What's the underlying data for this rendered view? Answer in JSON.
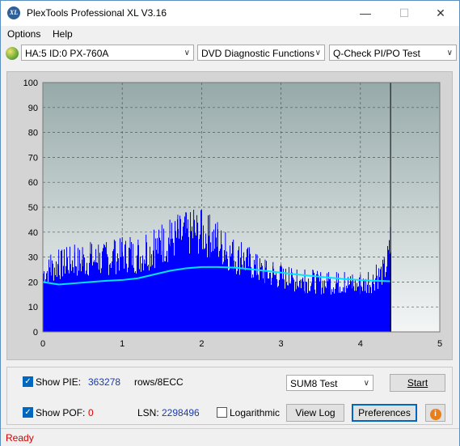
{
  "window": {
    "title": "PlexTools Professional XL V3.16",
    "icon": "xl-app-icon"
  },
  "menu": [
    {
      "label": "Options"
    },
    {
      "label": "Help"
    }
  ],
  "toolbar": {
    "drive": "HA:5 ID:0  PX-760A",
    "function": "DVD Diagnostic Functions",
    "test": "Q-Check PI/PO Test"
  },
  "chart_data": {
    "type": "bar",
    "title": "",
    "xlabel": "",
    "ylabel": "",
    "xlim": [
      0,
      5
    ],
    "ylim": [
      0,
      100
    ],
    "x_ticks": [
      "0",
      "1",
      "2",
      "3",
      "4",
      "5"
    ],
    "y_ticks": [
      "0",
      "10",
      "20",
      "30",
      "40",
      "50",
      "60",
      "70",
      "80",
      "90",
      "100"
    ],
    "grid": true,
    "end_marker_x": 4.38,
    "series": [
      {
        "name": "PIE",
        "color": "#0000ff",
        "x": [
          0.0,
          0.1,
          0.2,
          0.3,
          0.4,
          0.5,
          0.6,
          0.7,
          0.8,
          0.9,
          1.0,
          1.1,
          1.2,
          1.3,
          1.4,
          1.5,
          1.6,
          1.7,
          1.8,
          1.9,
          2.0,
          2.1,
          2.2,
          2.3,
          2.4,
          2.5,
          2.6,
          2.7,
          2.8,
          2.9,
          3.0,
          3.1,
          3.2,
          3.3,
          3.4,
          3.5,
          3.6,
          3.7,
          3.8,
          3.9,
          4.0,
          4.1,
          4.2,
          4.3,
          4.38
        ],
        "values": [
          29,
          31,
          33,
          34,
          35,
          34,
          36,
          35,
          36,
          37,
          38,
          38,
          37,
          39,
          41,
          43,
          45,
          47,
          48,
          49,
          49,
          47,
          44,
          40,
          37,
          36,
          34,
          31,
          29,
          28,
          27,
          26,
          25,
          25,
          25,
          24,
          24,
          24,
          24,
          23,
          23,
          24,
          27,
          30,
          42
        ]
      },
      {
        "name": "PIE average",
        "color": "#00e5ff",
        "x": [
          0.0,
          0.2,
          0.4,
          0.6,
          0.8,
          1.0,
          1.2,
          1.4,
          1.6,
          1.8,
          2.0,
          2.2,
          2.4,
          2.6,
          2.8,
          3.0,
          3.2,
          3.4,
          3.6,
          3.8,
          4.0,
          4.2,
          4.38
        ],
        "values": [
          20,
          19,
          19.5,
          20,
          20.5,
          20.8,
          21.5,
          23,
          24.5,
          25.5,
          26,
          26,
          25.8,
          25.2,
          24.5,
          23.8,
          23,
          22.4,
          21.8,
          21.2,
          20.8,
          20.5,
          20.3
        ]
      }
    ]
  },
  "controls": {
    "show_pie": {
      "label": "Show PIE:",
      "value": "363278",
      "unit": "rows/8ECC",
      "checked": true
    },
    "show_pof": {
      "label": "Show POF:",
      "value": "0",
      "checked": true
    },
    "lsn": {
      "label": "LSN:",
      "value": "2298496"
    },
    "logarithmic": {
      "label": "Logarithmic",
      "checked": false
    },
    "sum_select": "SUM8 Test",
    "start_button": "Start",
    "view_log_button": "View Log",
    "preferences_button": "Preferences"
  },
  "status": "Ready"
}
